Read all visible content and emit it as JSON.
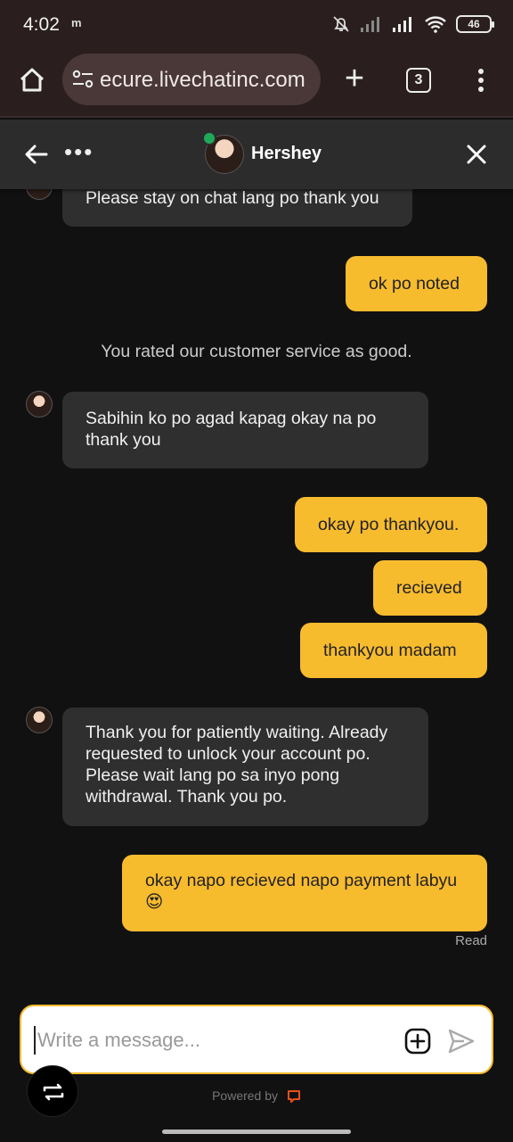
{
  "status_bar": {
    "time": "4:02",
    "notification": "m",
    "battery": "46"
  },
  "browser": {
    "url": "ecure.livechatinc.com",
    "tab_count": "3"
  },
  "chat": {
    "agent_name": "Hershey",
    "messages": [
      {
        "from": "agent",
        "text": "Please stay on chat lang po thank you"
      },
      {
        "from": "user",
        "text": "ok po noted"
      },
      {
        "from": "system",
        "text": "You rated our customer service as good."
      },
      {
        "from": "agent",
        "text": "Sabihin ko po agad kapag okay na po thank you"
      },
      {
        "from": "user",
        "text": "okay po thankyou."
      },
      {
        "from": "user",
        "text": "recieved"
      },
      {
        "from": "user",
        "text": "thankyou madam"
      },
      {
        "from": "agent",
        "text": "Thank you for patiently waiting. Already requested to unlock your account po. Please wait lang po sa inyo pong withdrawal. Thank you po."
      },
      {
        "from": "user",
        "text": "okay napo recieved napo payment labyu 😍"
      }
    ],
    "read_status": "Read"
  },
  "composer": {
    "placeholder": "Write a message...",
    "powered_by": "Powered by"
  },
  "colors": {
    "accent": "#f7bb2e",
    "agent_bubble": "#2f2f2f",
    "background": "#111111",
    "online": "#1fa85a"
  }
}
